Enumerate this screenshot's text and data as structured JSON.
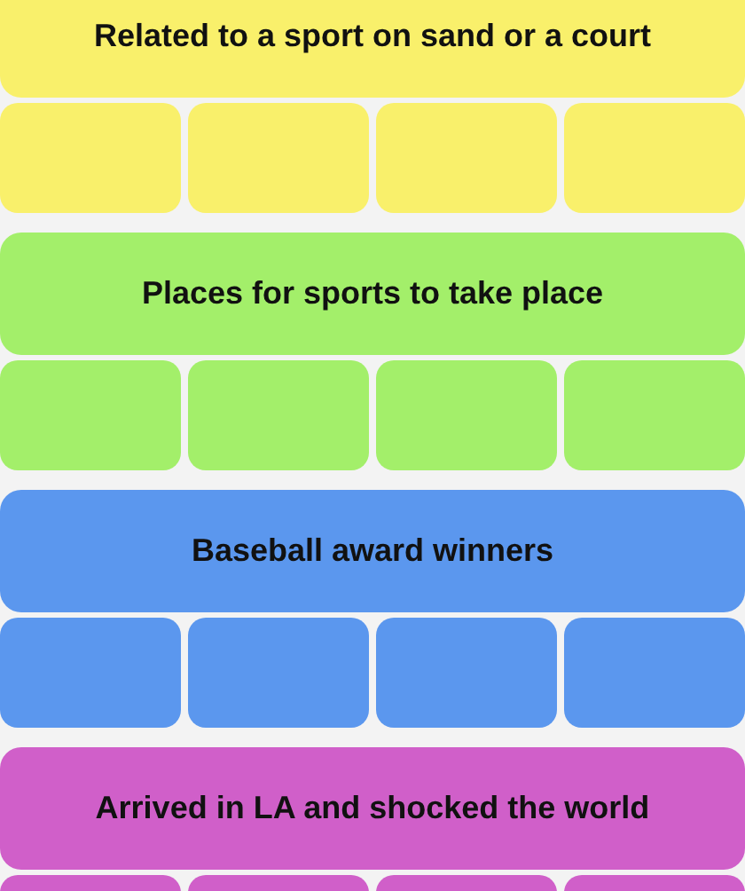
{
  "groups": [
    {
      "title": "Related to a sport on sand or a court",
      "color": "#f9f06b"
    },
    {
      "title": "Places for sports to take place",
      "color": "#a3ef6a"
    },
    {
      "title": "Baseball award winners",
      "color": "#5b97ee"
    },
    {
      "title": "Arrived in LA and shocked the world",
      "color": "#d05fc9"
    }
  ]
}
